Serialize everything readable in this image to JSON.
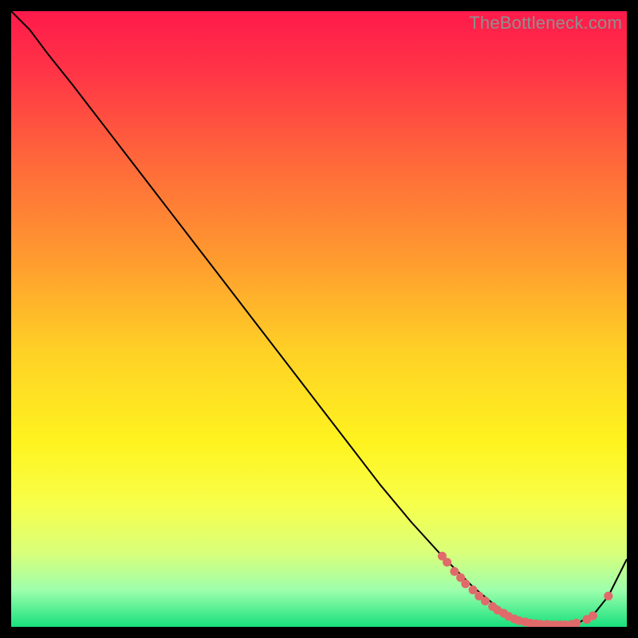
{
  "watermark": "TheBottleneck.com",
  "chart_data": {
    "type": "line",
    "title": "",
    "xlabel": "",
    "ylabel": "",
    "xlim": [
      0,
      100
    ],
    "ylim": [
      0,
      100
    ],
    "grid": false,
    "legend": false,
    "background_gradient": {
      "stops": [
        {
          "offset": 0.0,
          "color": "#ff1a4b"
        },
        {
          "offset": 0.1,
          "color": "#ff3546"
        },
        {
          "offset": 0.25,
          "color": "#ff6a3a"
        },
        {
          "offset": 0.4,
          "color": "#ff9a2f"
        },
        {
          "offset": 0.55,
          "color": "#ffd026"
        },
        {
          "offset": 0.7,
          "color": "#fff31f"
        },
        {
          "offset": 0.8,
          "color": "#f7ff4a"
        },
        {
          "offset": 0.88,
          "color": "#d9ff7a"
        },
        {
          "offset": 0.94,
          "color": "#9dffac"
        },
        {
          "offset": 1.0,
          "color": "#18e07e"
        }
      ]
    },
    "series": [
      {
        "name": "curve",
        "color": "#000000",
        "x": [
          0,
          3,
          6,
          10,
          15,
          20,
          25,
          30,
          35,
          40,
          45,
          50,
          55,
          60,
          65,
          70,
          73,
          75,
          78,
          80,
          82,
          85,
          88,
          90,
          92,
          95,
          97,
          100
        ],
        "y": [
          100,
          97,
          93,
          88,
          81.5,
          75,
          68.5,
          62,
          55.5,
          49,
          42.5,
          36,
          29.5,
          23,
          17,
          11.5,
          8.5,
          6.5,
          4,
          2.5,
          1.5,
          0.8,
          0.4,
          0.3,
          0.5,
          2.5,
          5,
          11
        ]
      }
    ],
    "points": {
      "name": "dots",
      "color": "#e06a6a",
      "x": [
        70.0,
        70.8,
        72.0,
        73.0,
        73.8,
        75.0,
        76.0,
        77.0,
        78.2,
        79.0,
        80.0,
        80.8,
        81.7,
        82.5,
        83.5,
        84.3,
        85.2,
        86.0,
        87.0,
        87.8,
        88.5,
        89.3,
        90.0,
        91.0,
        91.8,
        93.5,
        94.5,
        97.0
      ],
      "y": [
        11.5,
        10.5,
        9.0,
        8.0,
        7.0,
        6.0,
        5.0,
        4.2,
        3.3,
        2.7,
        2.2,
        1.7,
        1.3,
        1.0,
        0.8,
        0.6,
        0.5,
        0.4,
        0.4,
        0.3,
        0.3,
        0.3,
        0.3,
        0.4,
        0.6,
        1.2,
        1.8,
        5.0
      ]
    }
  }
}
